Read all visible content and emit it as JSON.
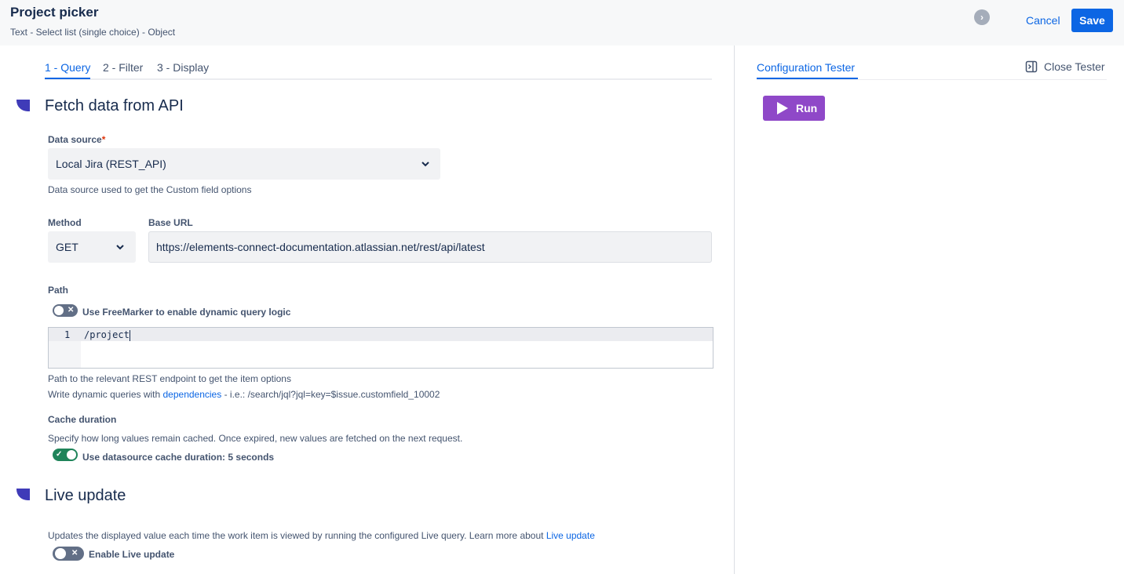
{
  "header": {
    "title": "Project picker",
    "subtitle": "Text - Select list (single choice) - Object",
    "nav_icon": "chevron-right-icon",
    "cancel_label": "Cancel",
    "save_label": "Save"
  },
  "tabs": [
    {
      "label": "1 - Query",
      "active": true
    },
    {
      "label": "2 - Filter",
      "active": false
    },
    {
      "label": "3 - Display",
      "active": false
    }
  ],
  "fetch_section": {
    "title": "Fetch data from API",
    "data_source": {
      "label": "Data source",
      "required_mark": "*",
      "value": "Local Jira (REST_API)",
      "help": "Data source used to get the Custom field options"
    },
    "method": {
      "label": "Method",
      "value": "GET"
    },
    "base_url": {
      "label": "Base URL",
      "value": "https://elements-connect-documentation.atlassian.net/rest/api/latest"
    },
    "path": {
      "label": "Path",
      "freemarker_toggle": {
        "label": "Use FreeMarker to enable dynamic query logic",
        "on": false
      },
      "editor": {
        "line_number": "1",
        "code": "/project"
      },
      "help1": "Path to the relevant REST endpoint to get the item options",
      "help2_prefix": "Write dynamic queries with ",
      "help2_link": "dependencies",
      "help2_suffix": " - i.e.: /search/jql?jql=key=$issue.customfield_10002"
    },
    "cache": {
      "label": "Cache duration",
      "help": "Specify how long values remain cached. Once expired, new values are fetched on the next request.",
      "toggle": {
        "label": "Use datasource cache duration: 5 seconds",
        "on": true
      }
    }
  },
  "live_section": {
    "title": "Live update",
    "help_prefix": "Updates the displayed value each time the work item is viewed by running the configured Live query. Learn more about ",
    "help_link": "Live update",
    "toggle": {
      "label": "Enable Live update",
      "on": false
    }
  },
  "tester": {
    "tab_label": "Configuration Tester",
    "close_label": "Close Tester",
    "run_label": "Run"
  },
  "colors": {
    "accent": "#0c66e4",
    "run_button": "#8f48c8",
    "toggle_on": "#1f845a",
    "toggle_off": "#626f86",
    "section_marker": "#3f3bb8"
  }
}
